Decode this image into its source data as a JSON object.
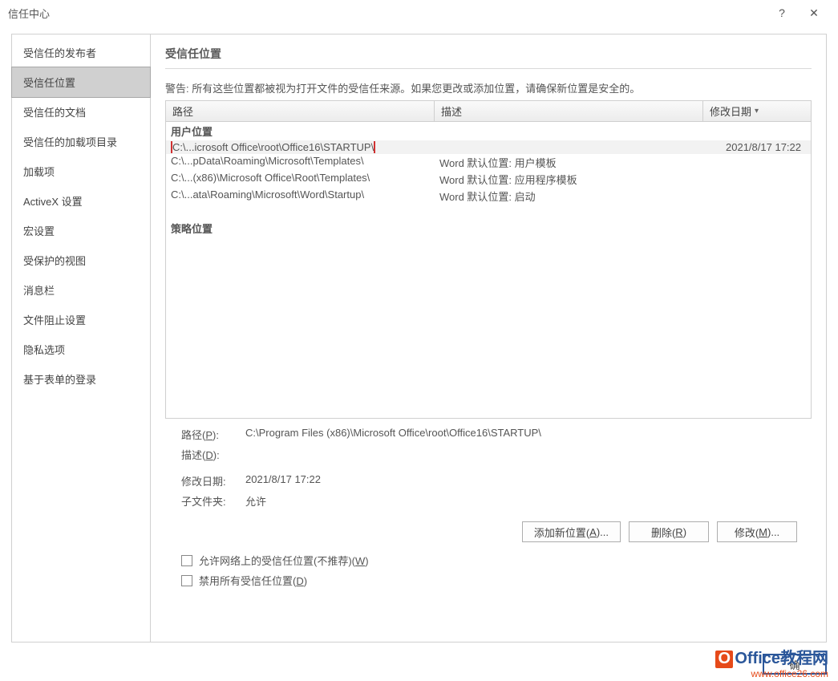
{
  "titlebar": {
    "title": "信任中心",
    "help": "?",
    "close": "✕"
  },
  "sidebar": {
    "items": [
      {
        "label": "受信任的发布者"
      },
      {
        "label": "受信任位置",
        "selected": true
      },
      {
        "label": "受信任的文档"
      },
      {
        "label": "受信任的加载项目录"
      },
      {
        "label": "加载项"
      },
      {
        "label": "ActiveX 设置"
      },
      {
        "label": "宏设置"
      },
      {
        "label": "受保护的视图"
      },
      {
        "label": "消息栏"
      },
      {
        "label": "文件阻止设置"
      },
      {
        "label": "隐私选项"
      },
      {
        "label": "基于表单的登录"
      }
    ]
  },
  "main": {
    "title": "受信任位置",
    "warning": "警告: 所有这些位置都被视为打开文件的受信任来源。如果您更改或添加位置，请确保新位置是安全的。",
    "columns": {
      "path": "路径",
      "desc": "描述",
      "date": "修改日期"
    },
    "groups": {
      "user": "用户位置",
      "policy": "策略位置"
    },
    "rows": [
      {
        "path": "C:\\...icrosoft Office\\root\\Office16\\STARTUP\\",
        "desc": "",
        "date": "2021/8/17 17:22",
        "selected": true,
        "highlight": true
      },
      {
        "path": "C:\\...pData\\Roaming\\Microsoft\\Templates\\",
        "desc": "Word 默认位置: 用户模板",
        "date": ""
      },
      {
        "path": "C:\\...(x86)\\Microsoft Office\\Root\\Templates\\",
        "desc": "Word 默认位置: 应用程序模板",
        "date": ""
      },
      {
        "path": "C:\\...ata\\Roaming\\Microsoft\\Word\\Startup\\",
        "desc": "Word 默认位置: 启动",
        "date": ""
      }
    ],
    "details": {
      "path_label_pre": "路径(",
      "path_label_u": "P",
      "path_label_post": "):",
      "path_value": "C:\\Program Files (x86)\\Microsoft Office\\root\\Office16\\STARTUP\\",
      "desc_label_pre": "描述(",
      "desc_label_u": "D",
      "desc_label_post": "):",
      "desc_value": "",
      "date_label": "修改日期:",
      "date_value": "2021/8/17 17:22",
      "sub_label": "子文件夹:",
      "sub_value": "允许"
    },
    "buttons": {
      "add_pre": "添加新位置(",
      "add_u": "A",
      "add_post": ")...",
      "del_pre": "删除(",
      "del_u": "R",
      "del_post": ")",
      "mod_pre": "修改(",
      "mod_u": "M",
      "mod_post": ")..."
    },
    "checks": {
      "c1_pre": "允许网络上的受信任位置(不推荐)(",
      "c1_u": "W",
      "c1_post": ")",
      "c2_pre": "禁用所有受信任位置(",
      "c2_u": "D",
      "c2_post": ")"
    }
  },
  "footer": {
    "ok": "确"
  },
  "watermark": {
    "top1": "O",
    "top2": "ffice",
    "top3": "教程网",
    "sub": "www.office26.com"
  }
}
